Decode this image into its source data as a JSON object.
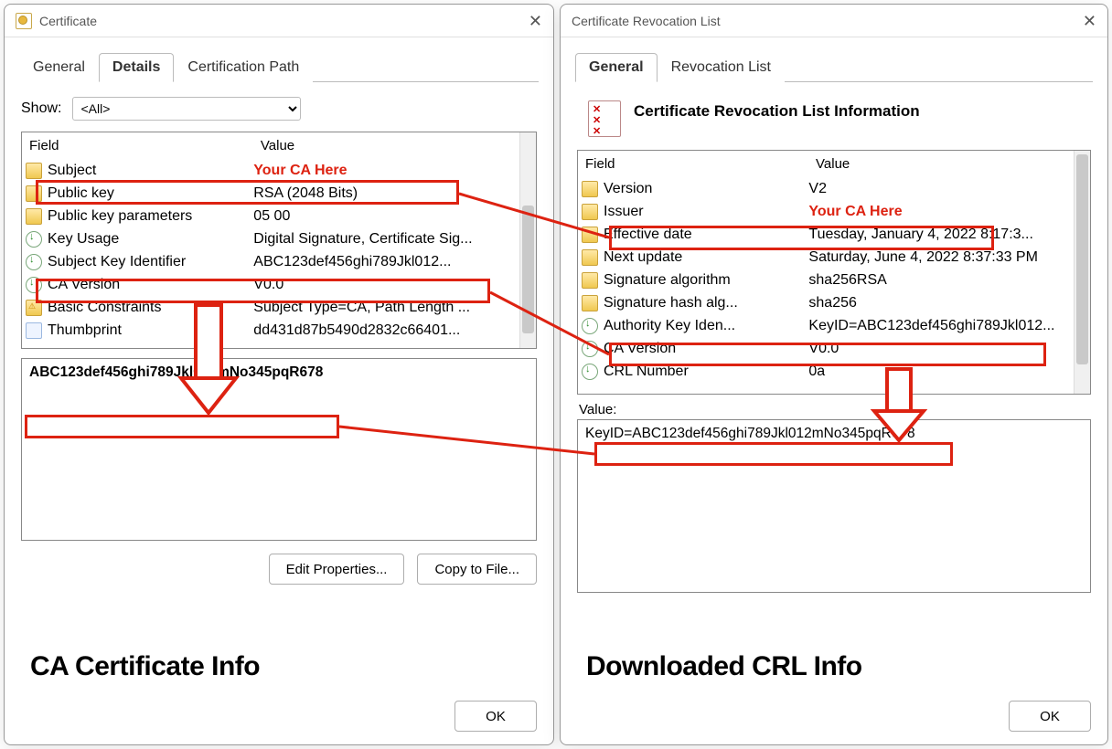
{
  "left_dialog": {
    "title": "Certificate",
    "tabs": {
      "general": "General",
      "details": "Details",
      "certpath": "Certification Path"
    },
    "active_tab": "details",
    "show_label": "Show:",
    "show_value": "<All>",
    "header_field": "Field",
    "header_value": "Value",
    "rows": [
      {
        "icon": "yellow",
        "field": "Subject",
        "value": "Your CA Here",
        "highlight_value": true
      },
      {
        "icon": "yellow",
        "field": "Public key",
        "value": "RSA (2048 Bits)"
      },
      {
        "icon": "yellow",
        "field": "Public key parameters",
        "value": "05 00"
      },
      {
        "icon": "green",
        "field": "Key Usage",
        "value": "Digital Signature, Certificate Sig..."
      },
      {
        "icon": "green",
        "field": "Subject Key Identifier",
        "value": "ABC123def456ghi789Jkl012..."
      },
      {
        "icon": "green",
        "field": "CA Version",
        "value": "V0.0"
      },
      {
        "icon": "lock",
        "field": "Basic Constraints",
        "value": "Subject Type=CA, Path Length ..."
      },
      {
        "icon": "thumb",
        "field": "Thumbprint",
        "value": "dd431d87b5490d2832c66401..."
      }
    ],
    "detail_text": "ABC123def456ghi789Jkl012mNo345pqR678",
    "btn_edit": "Edit Properties...",
    "btn_copy": "Copy to File...",
    "btn_ok": "OK",
    "caption": "CA Certificate Info"
  },
  "right_dialog": {
    "title": "Certificate Revocation List",
    "tabs": {
      "general": "General",
      "revlist": "Revocation List"
    },
    "active_tab": "general",
    "crl_title": "Certificate Revocation List Information",
    "header_field": "Field",
    "header_value": "Value",
    "rows": [
      {
        "icon": "yellow",
        "field": "Version",
        "value": "V2"
      },
      {
        "icon": "yellow",
        "field": "Issuer",
        "value": "Your CA Here",
        "highlight_value": true
      },
      {
        "icon": "yellow",
        "field": "Effective date",
        "value": "Tuesday, January 4, 2022 8:17:3..."
      },
      {
        "icon": "yellow",
        "field": "Next update",
        "value": "Saturday, June 4, 2022 8:37:33 PM"
      },
      {
        "icon": "yellow",
        "field": "Signature algorithm",
        "value": "sha256RSA"
      },
      {
        "icon": "yellow",
        "field": "Signature hash alg...",
        "value": "sha256"
      },
      {
        "icon": "green",
        "field": "Authority Key Iden...",
        "value": "KeyID=ABC123def456ghi789Jkl012..."
      },
      {
        "icon": "green",
        "field": "CA Version",
        "value": "V0.0"
      },
      {
        "icon": "green",
        "field": "CRL Number",
        "value": "0a"
      }
    ],
    "value_label": "Value:",
    "value_text": "KeyID=ABC123def456ghi789Jkl012mNo345pqR678",
    "btn_ok": "OK",
    "caption": "Downloaded CRL Info"
  }
}
